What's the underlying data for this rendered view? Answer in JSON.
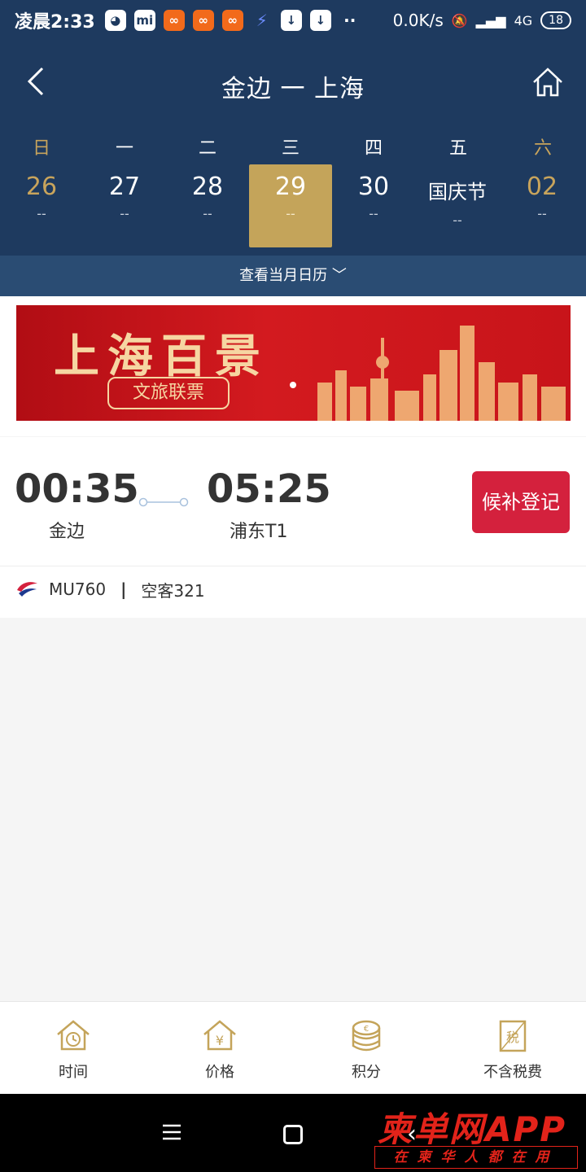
{
  "status_bar": {
    "time": "凌晨2:33",
    "speed": "0.0K/s",
    "network": "4G",
    "battery": "18"
  },
  "header": {
    "title": "金边 一 上海"
  },
  "week": {
    "days": [
      {
        "name": "日",
        "date": "26",
        "price": "--"
      },
      {
        "name": "一",
        "date": "27",
        "price": "--"
      },
      {
        "name": "二",
        "date": "28",
        "price": "--"
      },
      {
        "name": "三",
        "date": "29",
        "price": "--"
      },
      {
        "name": "四",
        "date": "30",
        "price": "--"
      },
      {
        "name": "五",
        "date": "国庆节",
        "price": "--"
      },
      {
        "name": "六",
        "date": "02",
        "price": "--"
      }
    ],
    "calendar_link": "查看当月日历 ﹀"
  },
  "banner": {
    "title": "上海百景",
    "subtitle": "文旅联票"
  },
  "flight": {
    "departure_time": "00:35",
    "departure_place": "金边",
    "arrival_time": "05:25",
    "arrival_place": "浦东T1",
    "action_label": "候补登记",
    "flight_no": "MU760",
    "separator": "|",
    "aircraft": "空客321"
  },
  "tabs": [
    {
      "label": "时间"
    },
    {
      "label": "价格"
    },
    {
      "label": "积分"
    },
    {
      "label": "不含税费"
    }
  ],
  "watermark": {
    "main": "柬单网APP",
    "sub": "在柬华人都在用"
  },
  "colors": {
    "navy": "#1e3a5f",
    "gold": "#c4a45a",
    "red": "#d4213d"
  }
}
